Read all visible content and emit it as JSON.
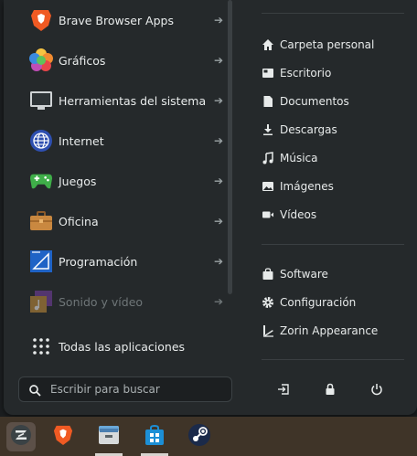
{
  "categories": [
    {
      "label": "Brave Browser Apps",
      "icon": "brave-icon",
      "dim": false
    },
    {
      "label": "Gráficos",
      "icon": "graphics-icon",
      "dim": false
    },
    {
      "label": "Herramientas del sistema",
      "icon": "system-tools-icon",
      "dim": false
    },
    {
      "label": "Internet",
      "icon": "internet-icon",
      "dim": false
    },
    {
      "label": "Juegos",
      "icon": "games-icon",
      "dim": false
    },
    {
      "label": "Oficina",
      "icon": "office-icon",
      "dim": false
    },
    {
      "label": "Programación",
      "icon": "programming-icon",
      "dim": false
    },
    {
      "label": "Sonido y vídeo",
      "icon": "sound-video-icon",
      "dim": true
    }
  ],
  "all_apps_label": "Todas las aplicaciones",
  "arrow_glyph": "➔",
  "places": [
    {
      "label": "Carpeta personal",
      "icon": "home-icon"
    },
    {
      "label": "Escritorio",
      "icon": "desktop-icon"
    },
    {
      "label": "Documentos",
      "icon": "document-icon"
    },
    {
      "label": "Descargas",
      "icon": "download-icon"
    },
    {
      "label": "Música",
      "icon": "music-icon"
    },
    {
      "label": "Imágenes",
      "icon": "image-icon"
    },
    {
      "label": "Vídeos",
      "icon": "video-icon"
    }
  ],
  "system_links": [
    {
      "label": "Software",
      "icon": "software-icon"
    },
    {
      "label": "Configuración",
      "icon": "settings-icon"
    },
    {
      "label": "Zorin Appearance",
      "icon": "appearance-icon"
    }
  ],
  "search": {
    "placeholder": "Escribir para buscar",
    "value": ""
  },
  "system_buttons": [
    "logout-icon",
    "lock-icon",
    "power-icon"
  ],
  "taskbar": [
    "zorin-menu-icon",
    "brave-icon",
    "files-icon",
    "store-icon",
    "steam-icon"
  ],
  "colors": {
    "panel": "#25292b",
    "taskbar": "#3f3428",
    "accent": "#e7eaea"
  }
}
